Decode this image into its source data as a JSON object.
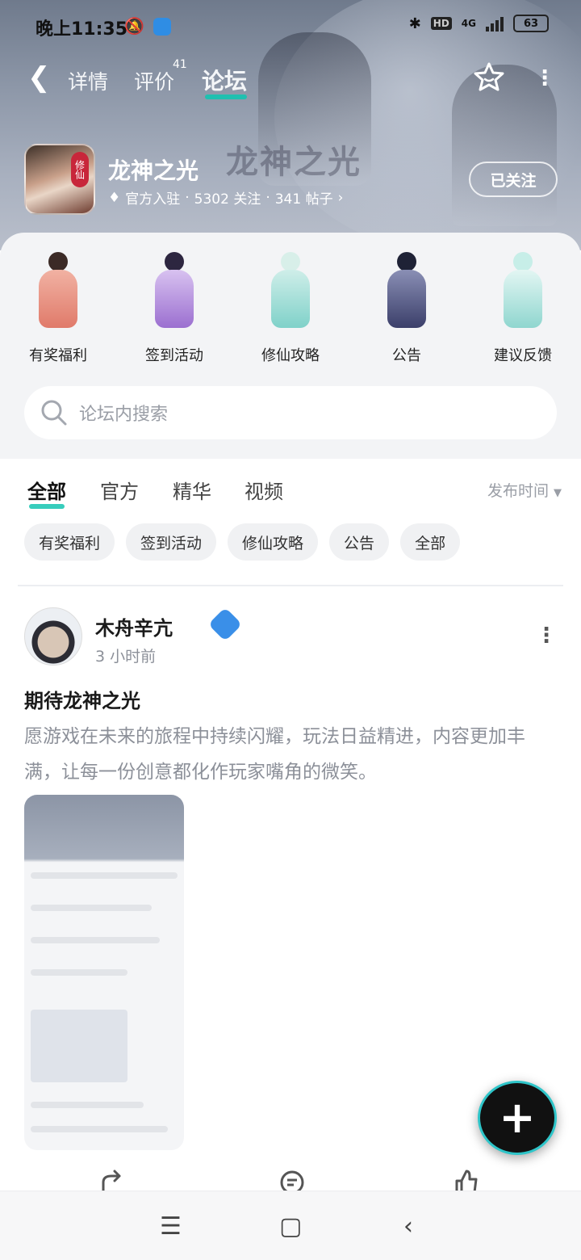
{
  "status_bar": {
    "time": "晚上11:35",
    "battery": "63",
    "network": "4G",
    "hd": "HD"
  },
  "nav": {
    "tabs": [
      {
        "label": "详情"
      },
      {
        "label": "评价",
        "count": "41"
      },
      {
        "label": "论坛"
      }
    ],
    "active_tab": "论坛"
  },
  "game": {
    "name": "龙神之光",
    "icon_tag": "修仙",
    "official": "官方入驻",
    "followers": "5302 关注",
    "posts": "341 帖子",
    "follow_label": "已关注",
    "watermark": "龙神之光"
  },
  "categories": [
    {
      "label": "有奖福利",
      "color": "#e07a6a"
    },
    {
      "label": "签到活动",
      "color": "#9b6fd0"
    },
    {
      "label": "修仙攻略",
      "color": "#7fd1c9"
    },
    {
      "label": "公告",
      "color": "#3b3f6a"
    },
    {
      "label": "建议反馈",
      "color": "#8fd6cf"
    }
  ],
  "search": {
    "placeholder": "论坛内搜索"
  },
  "filter_tabs": [
    {
      "label": "全部"
    },
    {
      "label": "官方"
    },
    {
      "label": "精华"
    },
    {
      "label": "视频"
    }
  ],
  "sort_label": "发布时间",
  "chips": [
    "有奖福利",
    "签到活动",
    "修仙攻略",
    "公告",
    "全部"
  ],
  "post": {
    "author": "木舟辛亢",
    "time": "3 小时前",
    "title": "期待龙神之光",
    "body": "愿游戏在未来的旅程中持续闪耀，玩法日益精进，内容更加丰满，让每一份创意都化作玩家嘴角的微笑。"
  },
  "colors": {
    "accent": "#14c4b0",
    "muted": "#8c9099"
  }
}
